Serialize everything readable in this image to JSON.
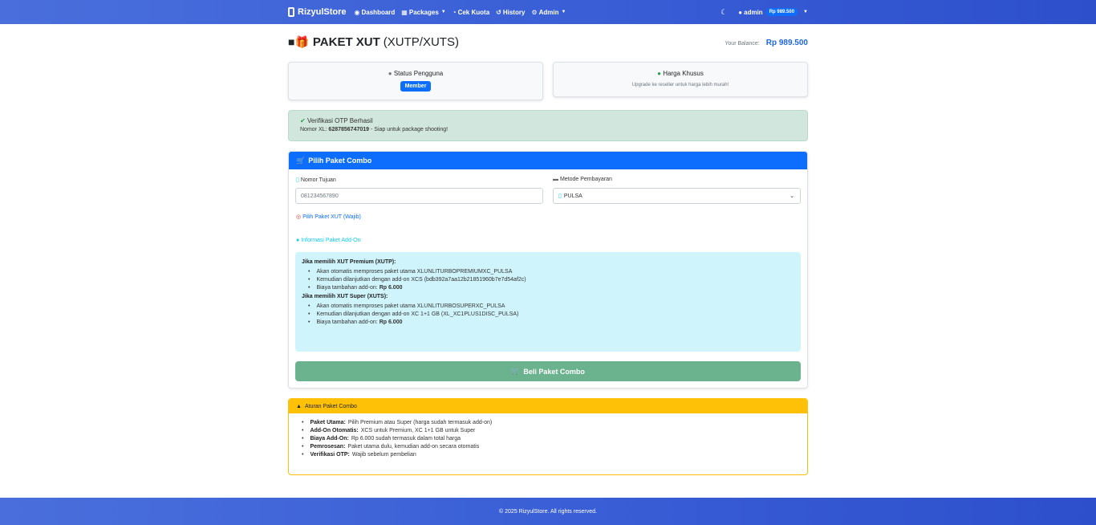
{
  "navbar": {
    "brand": "RizyulStore",
    "links": [
      {
        "icon": "dashboard-icon",
        "glyph": "◉",
        "label": "Dashboard"
      },
      {
        "icon": "box-icon",
        "glyph": "▦",
        "label": "Packages",
        "caret": true
      },
      {
        "icon": "chart-icon",
        "glyph": "◔",
        "label": "Cek Kuota"
      },
      {
        "icon": "history-icon",
        "glyph": "↺",
        "label": "History"
      },
      {
        "icon": "gear-icon",
        "glyph": "⚙",
        "label": "Admin",
        "caret": true
      }
    ],
    "user": "admin",
    "user_balance": "Rp 989.500"
  },
  "header": {
    "title_bold": "PAKET XUT",
    "title_rest": "(XUTP/XUTS)",
    "balance_label": "Your Balance:",
    "balance_value": "Rp 989.500"
  },
  "status_card": {
    "title": "Status Pengguna",
    "badge": "Member"
  },
  "price_card": {
    "title": "Harga Khusus",
    "subtitle": "Upgrade ke reseller untuk harga lebih murah!"
  },
  "otp_alert": {
    "title": "Verifikasi OTP Berhasil",
    "number_label": "Nomor XL:",
    "number": "6287856747019",
    "suffix": "- Siap untuk package shooting!"
  },
  "combo": {
    "header": "Pilih Paket Combo",
    "target_label": "Nomor Tujuan",
    "target_placeholder": "081234567890",
    "payment_label": "Metode Pembayaran",
    "payment_value": "PULSA",
    "choose_link": "Pilih Paket XUT (Wajib)",
    "addon_link": "Informasi Paket Add-On",
    "premium_title": "Jika memilih XUT Premium (XUTP):",
    "premium_items": [
      "Akan otomatis memproses paket utama XLUNLITURBOPREMIUMXC_PULSA",
      "Kemudian dilanjutkan dengan add-on XCS (bdb392a7aa12b21851960b7e7d54af2c)"
    ],
    "premium_cost_label": "Biaya tambahan add-on:",
    "premium_cost": "Rp 6.000",
    "super_title": "Jika memilih XUT Super (XUTS):",
    "super_items": [
      "Akan otomatis memproses paket utama XLUNLITURBOSUPERXC_PULSA",
      "Kemudian dilanjutkan dengan add-on XC 1+1 GB (XL_XC1PLUS1DISC_PULSA)"
    ],
    "super_cost_label": "Biaya tambahan add-on:",
    "super_cost": "Rp 6.000",
    "buy_button": "Beli Paket Combo"
  },
  "rules": {
    "header": "Aturan Paket Combo",
    "items": [
      {
        "key": "Paket Utama:",
        "text": "Pilih Premium atau Super (harga sudah termasuk add-on)"
      },
      {
        "key": "Add-On Otomatis:",
        "text": "XCS untuk Premium, XC 1+1 GB untuk Super"
      },
      {
        "key": "Biaya Add-On:",
        "text": "Rp 6.000 sudah termasuk dalam total harga"
      },
      {
        "key": "Pemrosesan:",
        "text": "Paket utama dulu, kemudian add-on secara otomatis"
      },
      {
        "key": "Verifikasi OTP:",
        "text": "Wajib sebelum pembelian"
      }
    ]
  },
  "footer": {
    "text": "© 2025 RizyulStore. All rights reserved."
  },
  "colors": {
    "primary": "#0d6efd",
    "success_btn": "#6bb28e",
    "warning": "#ffc107",
    "info_bg": "#cff4fc",
    "alert_bg": "#d1e7dd"
  }
}
